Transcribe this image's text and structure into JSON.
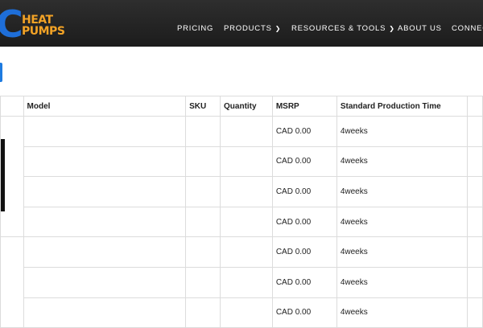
{
  "header": {
    "logo": {
      "letter": "C",
      "line1": "HEAT",
      "line2": "PUMPS"
    },
    "nav": [
      {
        "label": "PRICING",
        "dropdown": false
      },
      {
        "label": "PRODUCTS",
        "dropdown": true
      },
      {
        "label": "RESOURCES & TOOLS",
        "dropdown": true
      },
      {
        "label": "ABOUT US",
        "dropdown": false
      },
      {
        "label": "CONNEC",
        "dropdown": false
      }
    ]
  },
  "table": {
    "columns": [
      "",
      "Model",
      "SKU",
      "Quantity",
      "MSRP",
      "Standard Production Time",
      ""
    ],
    "rows": [
      {
        "model": "",
        "sku": "",
        "quantity": "",
        "msrp": "CAD 0.00",
        "production_time": "4weeks"
      },
      {
        "model": "",
        "sku": "",
        "quantity": "",
        "msrp": "CAD 0.00",
        "production_time": "4weeks"
      },
      {
        "model": "",
        "sku": "",
        "quantity": "",
        "msrp": "CAD 0.00",
        "production_time": "4weeks"
      },
      {
        "model": "",
        "sku": "",
        "quantity": "",
        "msrp": "CAD 0.00",
        "production_time": "4weeks"
      },
      {
        "model": "",
        "sku": "",
        "quantity": "",
        "msrp": "CAD 0.00",
        "production_time": "4weeks"
      },
      {
        "model": "",
        "sku": "",
        "quantity": "",
        "msrp": "CAD 0.00",
        "production_time": "4weeks"
      },
      {
        "model": "",
        "sku": "",
        "quantity": "",
        "msrp": "CAD 0.00",
        "production_time": "4weeks"
      }
    ]
  },
  "colors": {
    "header_bg": "#222222",
    "logo_blue": "#1e6ed8",
    "logo_orange": "#f3a326",
    "button_blue": "#1e7be0",
    "grid": "#dcdcdc"
  }
}
